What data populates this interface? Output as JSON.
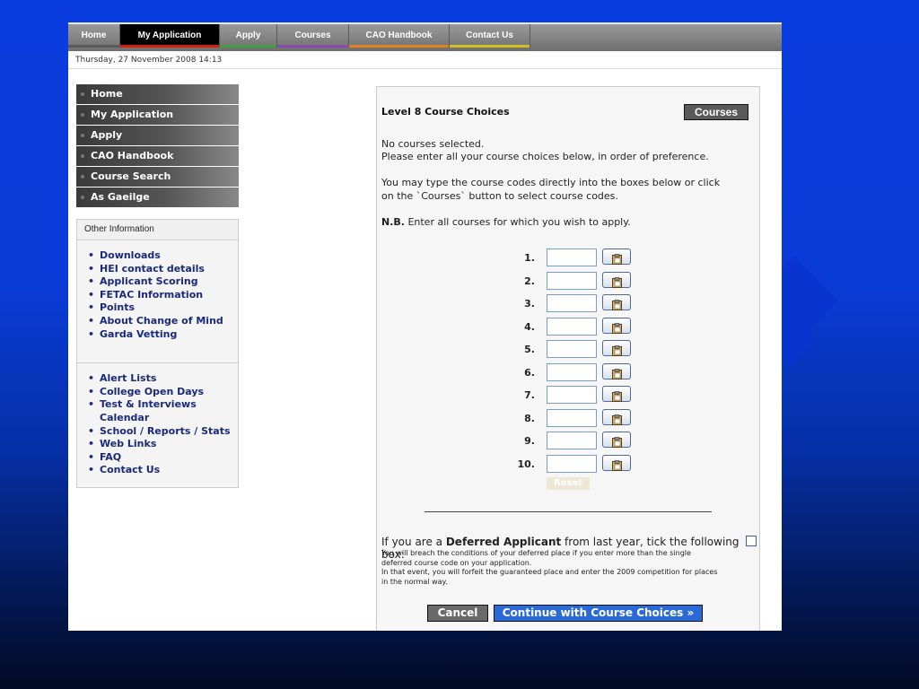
{
  "topnav": {
    "tabs": [
      {
        "label": "Home",
        "bar": "#5a5a5a",
        "active": false
      },
      {
        "label": "My Application",
        "bar": "#d02010",
        "active": true
      },
      {
        "label": "Apply",
        "bar": "#40a040",
        "active": false
      },
      {
        "label": "Courses",
        "bar": "#8a4ab0",
        "active": false
      },
      {
        "label": "CAO Handbook",
        "bar": "#e08020",
        "active": false
      },
      {
        "label": "Contact Us",
        "bar": "#d0c020",
        "active": false
      }
    ]
  },
  "datetime": "Thursday, 27 November 2008 14:13",
  "leftmenu": {
    "items": [
      "Home",
      "My Application",
      "Apply",
      "CAO Handbook",
      "Course Search",
      "As Gaeilge"
    ]
  },
  "other_info": {
    "title": "Other Information",
    "group1": [
      "Downloads",
      "HEI contact details",
      "Applicant Scoring",
      "FETAC Information",
      "Points",
      "About Change of Mind",
      "Garda Vetting"
    ],
    "group2": [
      "Alert Lists",
      "College Open Days",
      "Test & Interviews Calendar",
      "School / Reports / Stats",
      "Web Links",
      "FAQ",
      "Contact Us"
    ]
  },
  "panel": {
    "title": "Level 8 Course Choices",
    "courses_button": "Courses",
    "no_courses": "No courses selected.",
    "instruction": "Please enter all your course choices below, in order of preference.",
    "type_hint": "You may type the course codes directly into the boxes below or click on the `Courses` button to select course codes.",
    "nb_label": "N.B.",
    "nb_text": " Enter all courses for which you wish to apply.",
    "choice_numbers": [
      "1.",
      "2.",
      "3.",
      "4.",
      "5.",
      "6.",
      "7.",
      "8.",
      "9.",
      "10."
    ],
    "reset_label": "Reset",
    "deferred_prefix": "If you are a ",
    "deferred_bold": "Deferred Applicant",
    "deferred_suffix": " from last year, tick the following box:",
    "deferred_note1": "You will breach the conditions of your deferred place if you enter more than the single deferred course code on your application.",
    "deferred_note2": "In that event, you will forfeit the guaranteed place and enter the 2009 competition for places in the normal way.",
    "cancel_label": "Cancel",
    "continue_label": "Continue with Course Choices »"
  }
}
